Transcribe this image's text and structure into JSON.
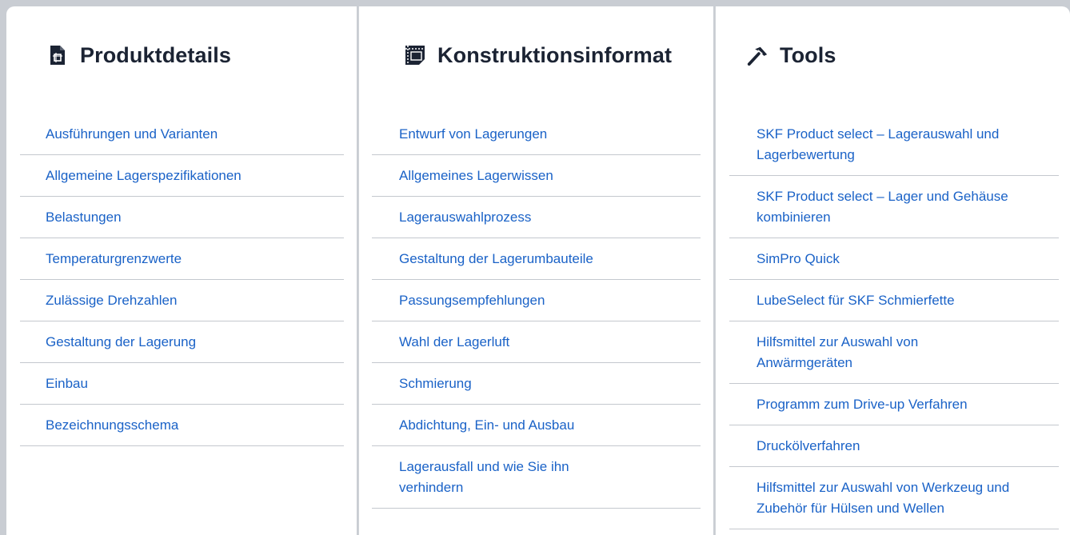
{
  "columns": [
    {
      "title": "Produktdetails",
      "icon": "document-frame-icon",
      "links": [
        "Ausführungen und Varianten",
        "Allgemeine Lagerspezifikationen",
        "Belastungen",
        "Temperaturgrenzwerte",
        "Zulässige Drehzahlen",
        "Gestaltung der Lagerung",
        "Einbau",
        "Bezeichnungsschema"
      ]
    },
    {
      "title": "Konstruktionsinformat",
      "icon": "blueprint-icon",
      "links": [
        "Entwurf von Lagerungen",
        "Allgemeines Lagerwissen",
        "Lagerauswahlprozess",
        "Gestaltung der Lagerumbauteile",
        "Passungsempfehlungen",
        "Wahl der Lagerluft",
        "Schmierung",
        "Abdichtung, Ein- und Ausbau",
        "Lagerausfall und wie Sie ihn verhindern"
      ]
    },
    {
      "title": "Tools",
      "icon": "hammer-icon",
      "links": [
        "SKF Product select – Lagerauswahl und Lagerbewertung",
        "SKF Product select – Lager und Gehäuse kombinieren",
        "SimPro Quick",
        "LubeSelect für SKF Schmierfette",
        "Hilfsmittel zur Auswahl von Anwärmgeräten",
        "Programm zum Drive-up Verfahren",
        "Druckölverfahren",
        "Hilfsmittel zur Auswahl von Werkzeug und Zubehör für Hülsen und Wellen"
      ]
    }
  ],
  "colors": {
    "link": "#1a62c7",
    "heading": "#1b2333",
    "divider": "#c4c8ce",
    "frame": "#c9cdd3"
  }
}
